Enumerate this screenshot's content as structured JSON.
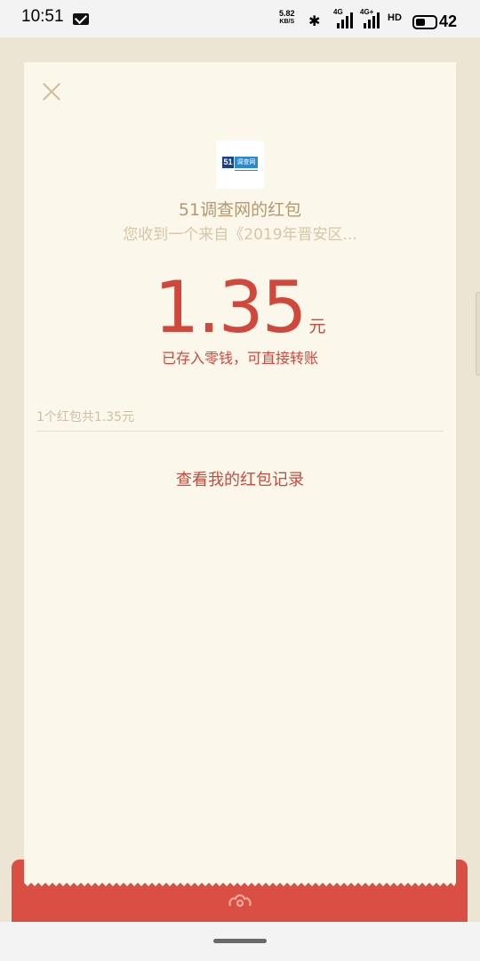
{
  "status_bar": {
    "time": "10:51",
    "net_speed_value": "5.82",
    "net_speed_unit": "KB/S",
    "sim1_tag": "4G",
    "sim2_tag": "4G+",
    "hd_label": "HD",
    "battery_level": "42"
  },
  "red_packet": {
    "sender_name": "51调查网的红包",
    "from_text": "您收到一个来自《2019年晋安区...",
    "amount": "1.35",
    "unit": "元",
    "stored_note": "已存入零钱，可直接转账",
    "summary": "1个红包共1.35元",
    "records_link": "查看我的红包记录",
    "logo_number": "51",
    "logo_text": "调查网"
  },
  "colors": {
    "accent_red": "#d2473b",
    "card_bg": "#fbf7ea",
    "page_bg": "#ede5d3",
    "base_red": "#d94f44",
    "sender_gold": "#b5986c"
  }
}
